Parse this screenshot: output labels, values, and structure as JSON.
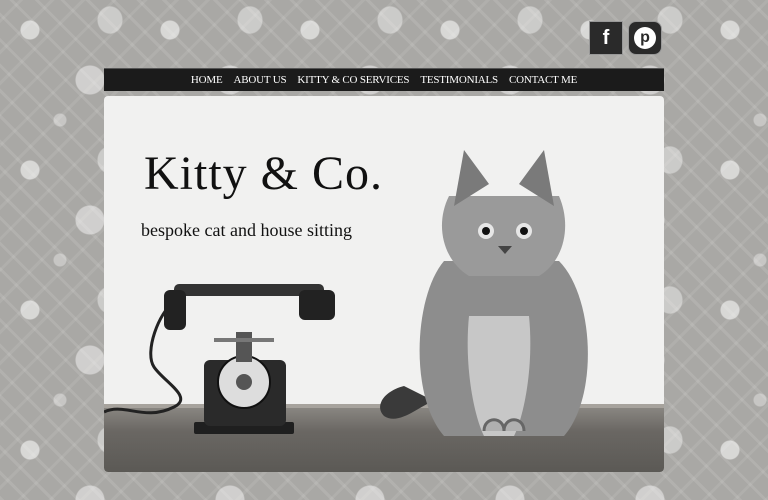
{
  "header": {
    "social": [
      {
        "name": "facebook",
        "icon": "facebook-icon",
        "glyph": "f"
      },
      {
        "name": "pinterest",
        "icon": "pinterest-icon",
        "glyph": "p"
      }
    ]
  },
  "nav": {
    "items": [
      "HOME",
      "ABOUT US",
      "KITTY & CO SERVICES",
      "TESTIMONIALS",
      "CONTACT ME"
    ]
  },
  "hero": {
    "title": "Kitty & Co.",
    "tagline": "bespoke cat and house sitting",
    "images": [
      "vintage-telephone-image",
      "tabby-cat-image"
    ]
  },
  "colors": {
    "nav_bg": "#1b1b1b",
    "hero_bg": "#f1f1f0",
    "page_bg": "#a9a8a5",
    "text": "#111111"
  }
}
